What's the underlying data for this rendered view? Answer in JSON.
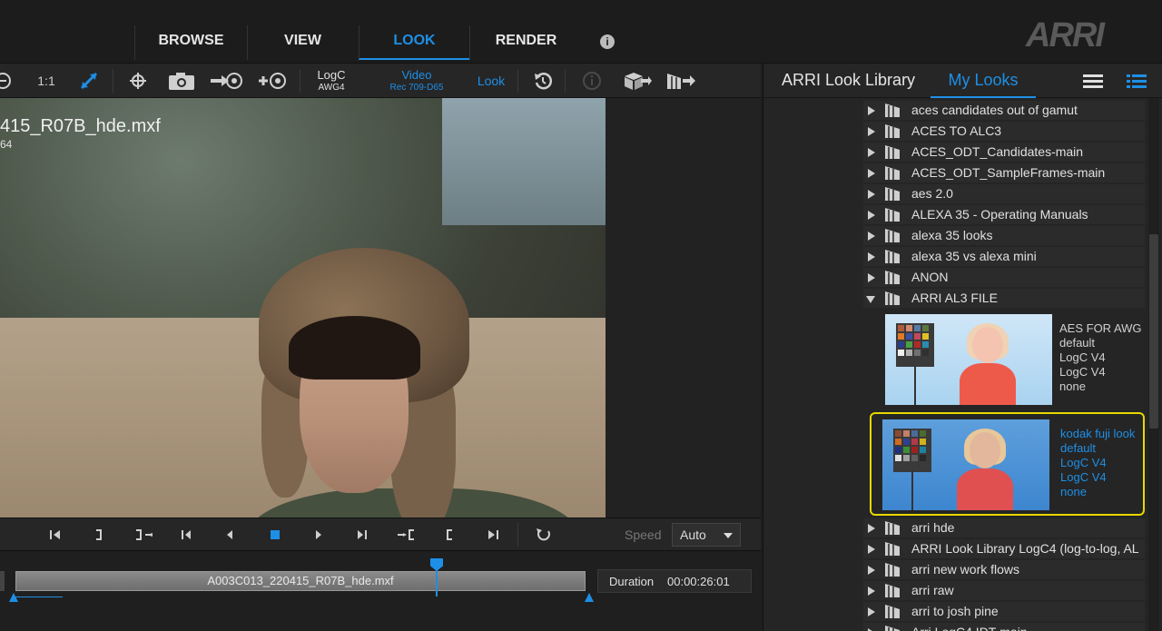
{
  "main_tabs": [
    {
      "label": "BROWSE"
    },
    {
      "label": "VIEW"
    },
    {
      "label": "LOOK",
      "active": true
    },
    {
      "label": "RENDER"
    }
  ],
  "info_icon": "i",
  "logo": "ARRI",
  "viewer_toolbar": {
    "zoom_label": "1:1",
    "input_cs": {
      "line1": "LogC",
      "line2": "AWG4"
    },
    "output_cs": {
      "line1": "Video",
      "line2": "Rec 709-D65"
    },
    "look_label": "Look",
    "icons": [
      "zoom-out-icon",
      "fit-icon",
      "crosshair-icon",
      "camera-icon",
      "export-frame-icon",
      "add-frame-icon",
      "reset-icon",
      "info-icon",
      "cube-export-icon",
      "look-export-icon"
    ]
  },
  "viewer": {
    "clip_name": "415_R07B_hde.mxf",
    "clip_sub": "64"
  },
  "transport": {
    "buttons": [
      "go-start",
      "mark-in",
      "goto-in",
      "step-back",
      "play-reverse",
      "stop",
      "play",
      "step-forward",
      "goto-out",
      "mark-out",
      "go-end",
      "loop"
    ],
    "speed_label": "Speed",
    "speed_value": "Auto"
  },
  "timeline": {
    "clip_label": "A003C013_220415_R07B_hde.mxf",
    "duration_label": "Duration",
    "duration_value": "00:00:26:01"
  },
  "library": {
    "tabs": [
      {
        "label": "ARRI Look Library"
      },
      {
        "label": "My Looks",
        "active": true
      }
    ],
    "folders_top": [
      "aces candidates out of gamut",
      "ACES TO ALC3",
      "ACES_ODT_Candidates-main",
      "ACES_ODT_SampleFrames-main",
      "aes 2.0",
      "ALEXA 35 - Operating Manuals",
      "alexa 35 looks",
      "alexa 35 vs alexa mini",
      "ANON"
    ],
    "expanded_folder": "ARRI AL3 FILE",
    "looks": [
      {
        "name": "AES FOR  AWG",
        "category": "default",
        "input": "LogC V4",
        "output": "LogC V4",
        "extra": "none"
      },
      {
        "name": "kodak fuji look",
        "category": "default",
        "input": "LogC V4",
        "output": "LogC V4",
        "extra": "none",
        "selected": true
      }
    ],
    "folders_bottom": [
      "arri hde",
      "ARRI Look Library LogC4 (log-to-log, AL",
      "arri new work flows",
      "arri raw",
      "arri to josh pine",
      "Arri LogC4 IDT-main"
    ]
  },
  "colors": {
    "accent": "#1e8fe6",
    "selection": "#e6d800",
    "background": "#1e1e1e"
  }
}
